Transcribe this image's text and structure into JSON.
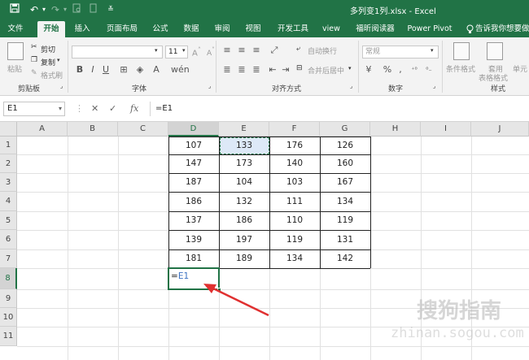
{
  "titlebar": {
    "title": "多列变1列.xlsx  -  Excel",
    "icons": [
      "save-icon",
      "undo-icon",
      "redo-icon",
      "print-preview-icon",
      "customize-icon"
    ]
  },
  "tabs": [
    "文件",
    "开始",
    "插入",
    "页面布局",
    "公式",
    "数据",
    "审阅",
    "视图",
    "开发工具",
    "view",
    "福昕阅读器",
    "Power Pivot",
    "告诉我你想要做什"
  ],
  "active_tab": "开始",
  "ribbon": {
    "clipboard": {
      "paste": "粘贴",
      "cut": "剪切",
      "copy": "复制",
      "format_painter": "格式刷",
      "label": "剪贴板"
    },
    "font": {
      "font_size": "11",
      "label": "字体",
      "bold": "B",
      "italic": "I",
      "underline": "U"
    },
    "alignment": {
      "wrap_text": "自动换行",
      "merge_center": "合并后居中",
      "label": "对齐方式"
    },
    "number": {
      "format": "常规",
      "label": "数字",
      "percent": "%",
      "comma": ","
    },
    "styles": {
      "conditional_format": "条件格式",
      "format_table_1": "套用",
      "format_table_2": "表格格式",
      "cell_styles": "单元",
      "label": "样式"
    }
  },
  "formula_bar": {
    "name_box": "E1",
    "formula": "=E1",
    "fx": "fx"
  },
  "columns": [
    "A",
    "B",
    "C",
    "D",
    "E",
    "F",
    "G",
    "H",
    "I",
    "J"
  ],
  "rows": [
    "1",
    "2",
    "3",
    "4",
    "5",
    "6",
    "7",
    "8",
    "9",
    "10",
    "11"
  ],
  "table": [
    [
      "107",
      "133",
      "176",
      "126"
    ],
    [
      "147",
      "173",
      "140",
      "160"
    ],
    [
      "187",
      "104",
      "103",
      "167"
    ],
    [
      "186",
      "132",
      "111",
      "134"
    ],
    [
      "137",
      "186",
      "110",
      "119"
    ],
    [
      "139",
      "197",
      "119",
      "131"
    ],
    [
      "181",
      "189",
      "134",
      "142"
    ]
  ],
  "active_cell": {
    "address": "D8",
    "formula_eq": "=",
    "formula_ref": "E1"
  },
  "copied_cell": "E1",
  "watermark": {
    "main": "搜狗指南",
    "sub": "zhinan.sogou.com"
  },
  "colors": {
    "excel_green": "#217346",
    "arrow_red": "#e03030",
    "ref_blue": "#3b71c2"
  }
}
